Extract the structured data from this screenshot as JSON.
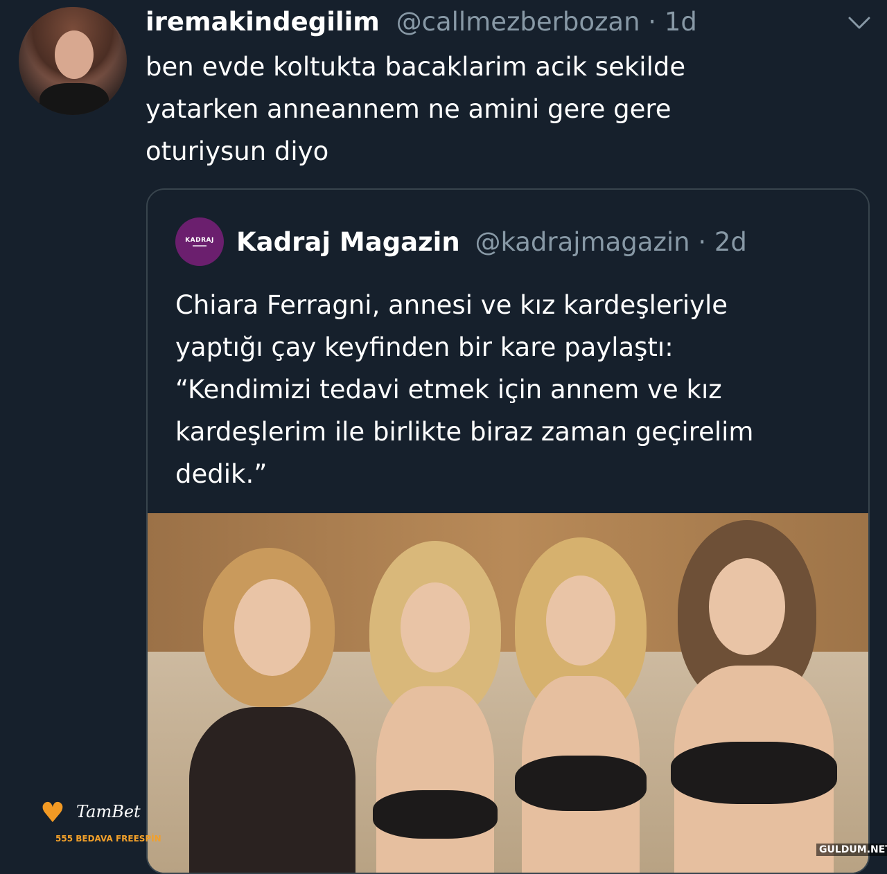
{
  "tweet": {
    "display_name": "iremakindegilim",
    "handle_time": "@callmezberbozan · 1d",
    "text": "ben evde koltukta bacaklarim acik sekilde\nyatarken anneannem ne amini gere gere\noturiysun diyo"
  },
  "quoted_tweet": {
    "avatar_logo_text": "KADRAJ",
    "display_name": "Kadraj Magazin",
    "handle_time": "@kadrajmagazin · 2d",
    "text": "Chiara Ferragni, annesi ve kız kardeşleriyle\nyaptığı çay keyfinden bir kare paylaştı:\n“Kendimizi tedavi etmek için annem ve kız\nkardeşlerim ile birlikte biraz zaman geçirelim\ndedik.”"
  },
  "overlay": {
    "brand": "TamBet",
    "promo": "555 BEDAVA FREESPİN",
    "watermark": "GULDUM.NET"
  },
  "icons": {
    "menu": "chevron-down-icon",
    "sticker": "heart-icon"
  },
  "colors": {
    "background": "#16202c",
    "handle": "#8899a6",
    "border": "#38444d",
    "logo": "#6b1f6e",
    "sticker_accent": "#f29a24"
  }
}
